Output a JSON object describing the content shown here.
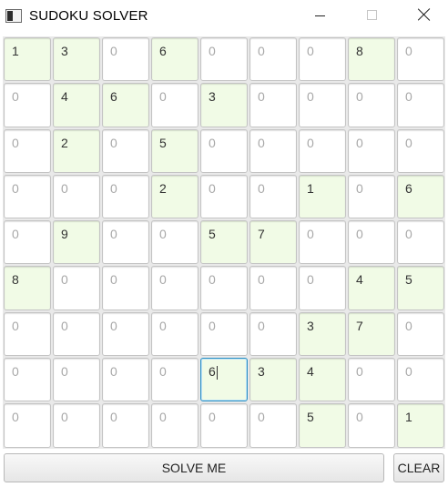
{
  "window": {
    "title": "SUDOKU SOLVER"
  },
  "board": {
    "rows": [
      [
        {
          "v": "1",
          "g": true
        },
        {
          "v": "3",
          "g": true
        },
        {
          "v": "0",
          "g": false
        },
        {
          "v": "6",
          "g": true
        },
        {
          "v": "0",
          "g": false
        },
        {
          "v": "0",
          "g": false
        },
        {
          "v": "0",
          "g": false
        },
        {
          "v": "8",
          "g": true
        },
        {
          "v": "0",
          "g": false
        }
      ],
      [
        {
          "v": "0",
          "g": false
        },
        {
          "v": "4",
          "g": true
        },
        {
          "v": "6",
          "g": true
        },
        {
          "v": "0",
          "g": false
        },
        {
          "v": "3",
          "g": true
        },
        {
          "v": "0",
          "g": false
        },
        {
          "v": "0",
          "g": false
        },
        {
          "v": "0",
          "g": false
        },
        {
          "v": "0",
          "g": false
        }
      ],
      [
        {
          "v": "0",
          "g": false
        },
        {
          "v": "2",
          "g": true
        },
        {
          "v": "0",
          "g": false
        },
        {
          "v": "5",
          "g": true
        },
        {
          "v": "0",
          "g": false
        },
        {
          "v": "0",
          "g": false
        },
        {
          "v": "0",
          "g": false
        },
        {
          "v": "0",
          "g": false
        },
        {
          "v": "0",
          "g": false
        }
      ],
      [
        {
          "v": "0",
          "g": false
        },
        {
          "v": "0",
          "g": false
        },
        {
          "v": "0",
          "g": false
        },
        {
          "v": "2",
          "g": true
        },
        {
          "v": "0",
          "g": false
        },
        {
          "v": "0",
          "g": false
        },
        {
          "v": "1",
          "g": true
        },
        {
          "v": "0",
          "g": false
        },
        {
          "v": "6",
          "g": true
        }
      ],
      [
        {
          "v": "0",
          "g": false
        },
        {
          "v": "9",
          "g": true
        },
        {
          "v": "0",
          "g": false
        },
        {
          "v": "0",
          "g": false
        },
        {
          "v": "5",
          "g": true
        },
        {
          "v": "7",
          "g": true
        },
        {
          "v": "0",
          "g": false
        },
        {
          "v": "0",
          "g": false
        },
        {
          "v": "0",
          "g": false
        }
      ],
      [
        {
          "v": "8",
          "g": true
        },
        {
          "v": "0",
          "g": false
        },
        {
          "v": "0",
          "g": false
        },
        {
          "v": "0",
          "g": false
        },
        {
          "v": "0",
          "g": false
        },
        {
          "v": "0",
          "g": false
        },
        {
          "v": "0",
          "g": false
        },
        {
          "v": "4",
          "g": true
        },
        {
          "v": "5",
          "g": true
        }
      ],
      [
        {
          "v": "0",
          "g": false
        },
        {
          "v": "0",
          "g": false
        },
        {
          "v": "0",
          "g": false
        },
        {
          "v": "0",
          "g": false
        },
        {
          "v": "0",
          "g": false
        },
        {
          "v": "0",
          "g": false
        },
        {
          "v": "3",
          "g": true
        },
        {
          "v": "7",
          "g": true
        },
        {
          "v": "0",
          "g": false
        }
      ],
      [
        {
          "v": "0",
          "g": false
        },
        {
          "v": "0",
          "g": false
        },
        {
          "v": "0",
          "g": false
        },
        {
          "v": "0",
          "g": false
        },
        {
          "v": "6",
          "g": true,
          "focused": true
        },
        {
          "v": "3",
          "g": true
        },
        {
          "v": "4",
          "g": true
        },
        {
          "v": "0",
          "g": false
        },
        {
          "v": "0",
          "g": false
        }
      ],
      [
        {
          "v": "0",
          "g": false
        },
        {
          "v": "0",
          "g": false
        },
        {
          "v": "0",
          "g": false
        },
        {
          "v": "0",
          "g": false
        },
        {
          "v": "0",
          "g": false
        },
        {
          "v": "0",
          "g": false
        },
        {
          "v": "5",
          "g": true
        },
        {
          "v": "0",
          "g": false
        },
        {
          "v": "1",
          "g": true
        }
      ]
    ]
  },
  "actions": {
    "solve_label": "SOLVE ME",
    "clear_label": "CLEAR"
  },
  "colors": {
    "given_cell": "#f1fbe6",
    "empty_cell": "#ffffff",
    "focus_border": "#2a8fc4"
  }
}
